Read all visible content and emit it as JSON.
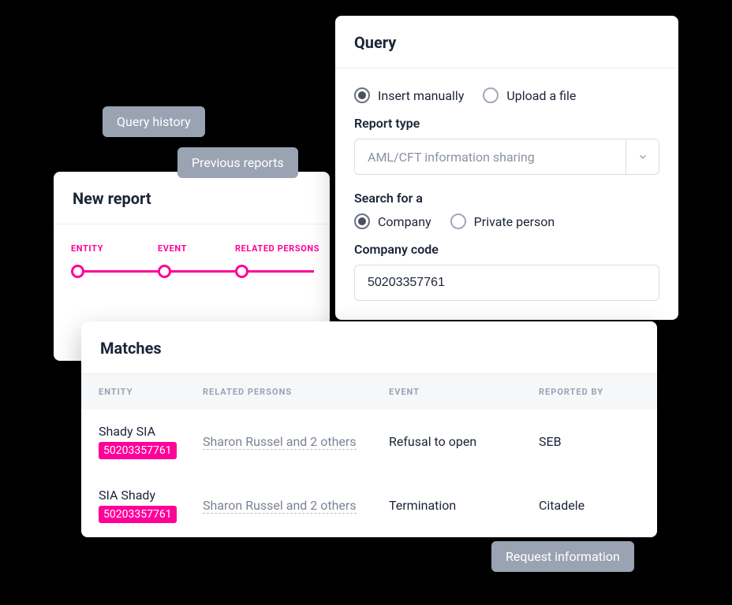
{
  "chips": {
    "query_history": "Query history",
    "previous_reports": "Previous reports",
    "request_information": "Request information"
  },
  "new_report": {
    "title": "New report",
    "steps": [
      "ENTITY",
      "EVENT",
      "RELATED PERSONS"
    ]
  },
  "query": {
    "title": "Query",
    "input_mode": {
      "insert_manually": "Insert manually",
      "upload_file": "Upload a file",
      "selected": "insert_manually"
    },
    "report_type_label": "Report type",
    "report_type_value": "AML/CFT information sharing",
    "search_for_label": "Search for a",
    "search_for": {
      "company": "Company",
      "private_person": "Private person",
      "selected": "company"
    },
    "company_code_label": "Company code",
    "company_code_value": "50203357761"
  },
  "matches": {
    "title": "Matches",
    "columns": {
      "entity": "ENTITY",
      "related_persons": "RELATED PERSONS",
      "event": "EVENT",
      "reported_by": "REPORTED BY"
    },
    "rows": [
      {
        "entity_name": "Shady SIA",
        "entity_code": "50203357761",
        "related_persons": "Sharon Russel and 2 others",
        "event": "Refusal to open",
        "reported_by": "SEB"
      },
      {
        "entity_name": "SIA Shady",
        "entity_code": "50203357761",
        "related_persons": "Sharon Russel and 2 others",
        "event": "Termination",
        "reported_by": "Citadele"
      }
    ]
  }
}
